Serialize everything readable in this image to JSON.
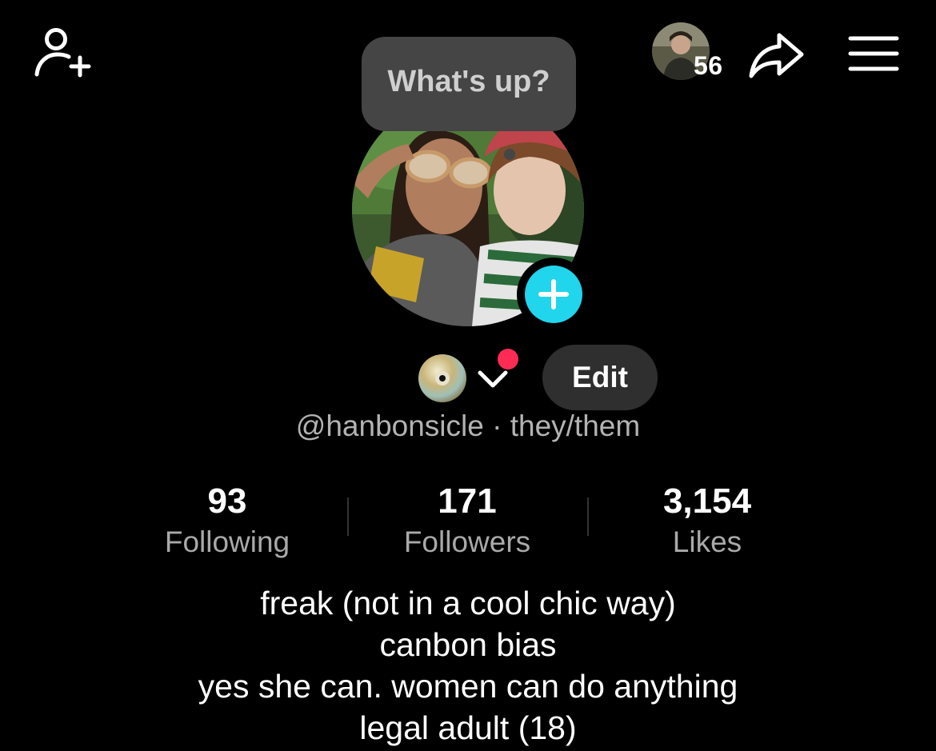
{
  "header": {
    "add_friend_icon": "person-plus-icon",
    "viewers_count": "56",
    "share_icon": "share-arrow-icon",
    "menu_icon": "hamburger-menu-icon"
  },
  "profile": {
    "note": "What's up?",
    "add_story_icon": "plus-icon",
    "account_icon": "cd-disc-icon",
    "edit_label": "Edit",
    "username": "@hanbonsicle",
    "separator": " · ",
    "pronouns": "they/them",
    "accent_color": "#20d5ec",
    "notification_color": "#fe2c55"
  },
  "stats": [
    {
      "value": "93",
      "label": "Following"
    },
    {
      "value": "171",
      "label": "Followers"
    },
    {
      "value": "3,154",
      "label": "Likes"
    }
  ],
  "bio": [
    "freak (not in a cool chic way)",
    "canbon bias",
    "yes she can. women can do anything",
    "legal adult (18)"
  ]
}
